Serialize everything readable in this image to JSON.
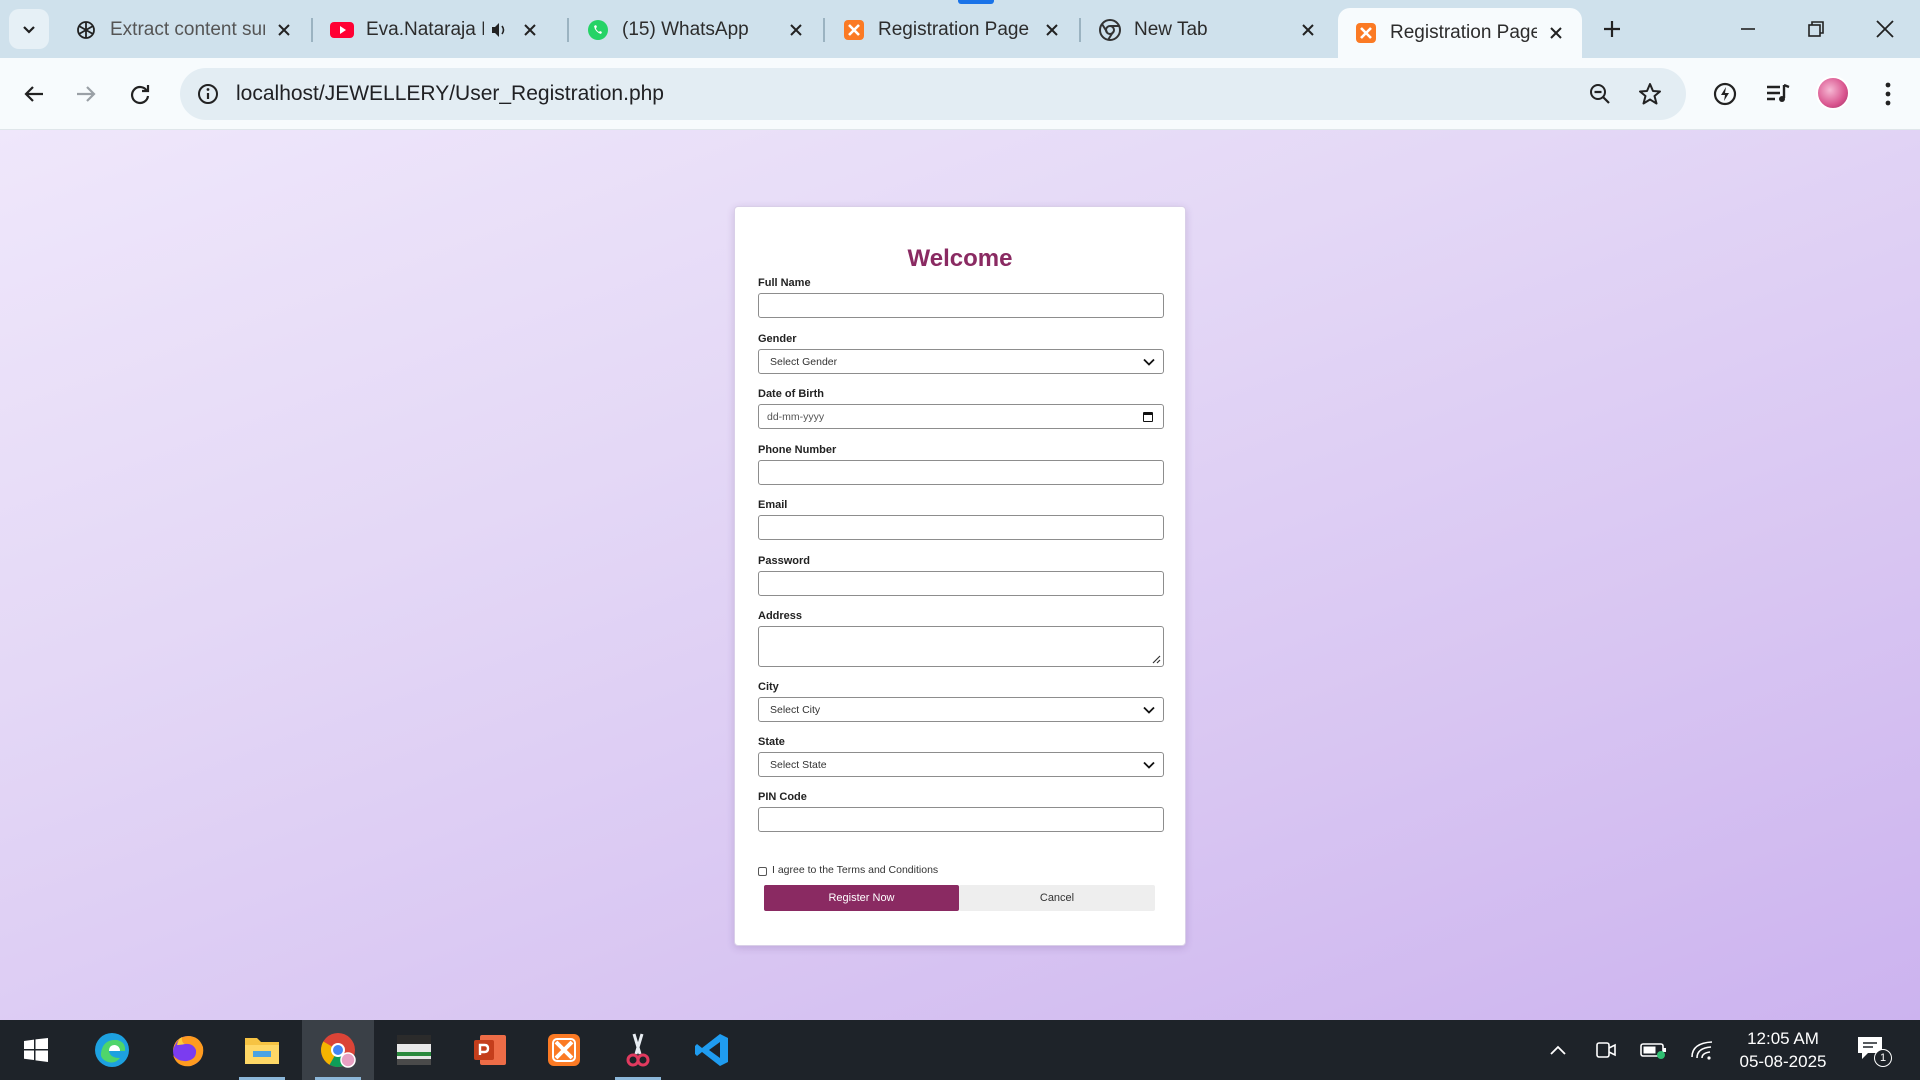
{
  "browser": {
    "tabs": [
      {
        "title": "Extract content sur",
        "icon": "chatgpt-icon"
      },
      {
        "title": "Eva.Nataraja M",
        "icon": "youtube-icon",
        "audio": true
      },
      {
        "title": "(15) WhatsApp",
        "icon": "whatsapp-icon"
      },
      {
        "title": "Registration Page",
        "icon": "xampp-icon"
      },
      {
        "title": "New Tab",
        "icon": "chrome-icon"
      },
      {
        "title": "Registration Page",
        "icon": "xampp-icon",
        "active": true
      }
    ],
    "url": "localhost/JEWELLERY/User_Registration.php"
  },
  "form": {
    "heading": "Welcome",
    "full_name_label": "Full Name",
    "full_name_value": "",
    "gender_label": "Gender",
    "gender_selected": "Select Gender",
    "dob_label": "Date of Birth",
    "dob_placeholder": "dd-mm-yyyy",
    "phone_label": "Phone Number",
    "phone_value": "",
    "email_label": "Email",
    "email_value": "",
    "password_label": "Password",
    "password_value": "",
    "address_label": "Address",
    "address_value": "",
    "city_label": "City",
    "city_selected": "Select City",
    "state_label": "State",
    "state_selected": "Select State",
    "pin_label": "PIN Code",
    "pin_value": "",
    "terms_label": "I agree to the Terms and Conditions",
    "terms_checked": false,
    "register_label": "Register Now",
    "cancel_label": "Cancel"
  },
  "taskbar": {
    "apps": [
      "windows-start",
      "edge",
      "firefox",
      "file-explorer",
      "chrome",
      "generic-app",
      "powerpoint",
      "xampp",
      "snipping-tool",
      "vscode"
    ],
    "time": "12:05 AM",
    "date": "05-08-2025",
    "notifications": "1"
  },
  "colors": {
    "accent": "#8a2a62",
    "page_gradient_start": "#efe7fb",
    "page_gradient_end": "#ccb3ef",
    "tabstrip": "#cfe1ec"
  }
}
